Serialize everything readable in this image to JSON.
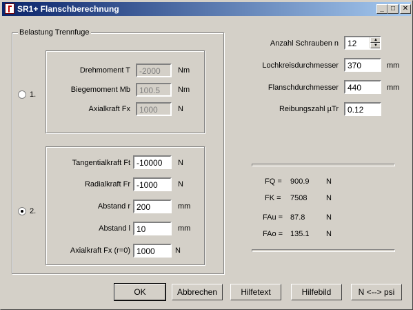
{
  "window": {
    "title": "SR1+ Flanschberechnung",
    "min": "_",
    "max": "□",
    "close": "✕"
  },
  "group": {
    "title": "Belastung Trennfuge"
  },
  "option1": {
    "radio_label": "1.",
    "checked": false,
    "drehmoment_label": "Drehmoment T",
    "drehmoment_value": "-2000",
    "drehmoment_unit": "Nm",
    "biegemoment_label": "Biegemoment Mb",
    "biegemoment_value": "100.5",
    "biegemoment_unit": "Nm",
    "axialkraft_label": "Axialkraft Fx",
    "axialkraft_value": "1000",
    "axialkraft_unit": "N"
  },
  "option2": {
    "radio_label": "2.",
    "checked": true,
    "tangential_label": "Tangentialkraft Ft",
    "tangential_value": "-10000",
    "tangential_unit": "N",
    "radial_label": "Radialkraft Fr",
    "radial_value": "-1000",
    "radial_unit": "N",
    "abstand_r_label": "Abstand r",
    "abstand_r_value": "200",
    "abstand_r_unit": "mm",
    "abstand_l_label": "Abstand l",
    "abstand_l_value": "10",
    "abstand_l_unit": "mm",
    "axialkraft_label": "Axialkraft Fx (r=0)",
    "axialkraft_value": "1000",
    "axialkraft_unit": "N"
  },
  "right": {
    "schrauben_label": "Anzahl Schrauben n",
    "schrauben_value": "12",
    "lochkreis_label": "Lochkreisdurchmesser",
    "lochkreis_value": "370",
    "lochkreis_unit": "mm",
    "flansch_label": "Flanschdurchmesser",
    "flansch_value": "440",
    "flansch_unit": "mm",
    "reibung_label": "Reibungszahl µTr",
    "reibung_value": "0.12"
  },
  "results": {
    "fq_label": "FQ =",
    "fq_value": "900.9",
    "fq_unit": "N",
    "fk_label": "FK =",
    "fk_value": "7508",
    "fk_unit": "N",
    "fau_label": "FAu =",
    "fau_value": "87.8",
    "fau_unit": "N",
    "fao_label": "FAo =",
    "fao_value": "135.1",
    "fao_unit": "N"
  },
  "buttons": {
    "ok": "OK",
    "abbrechen": "Abbrechen",
    "hilfetext": "Hilfetext",
    "hilfebild": "Hilfebild",
    "convert": "N <--> psi"
  }
}
